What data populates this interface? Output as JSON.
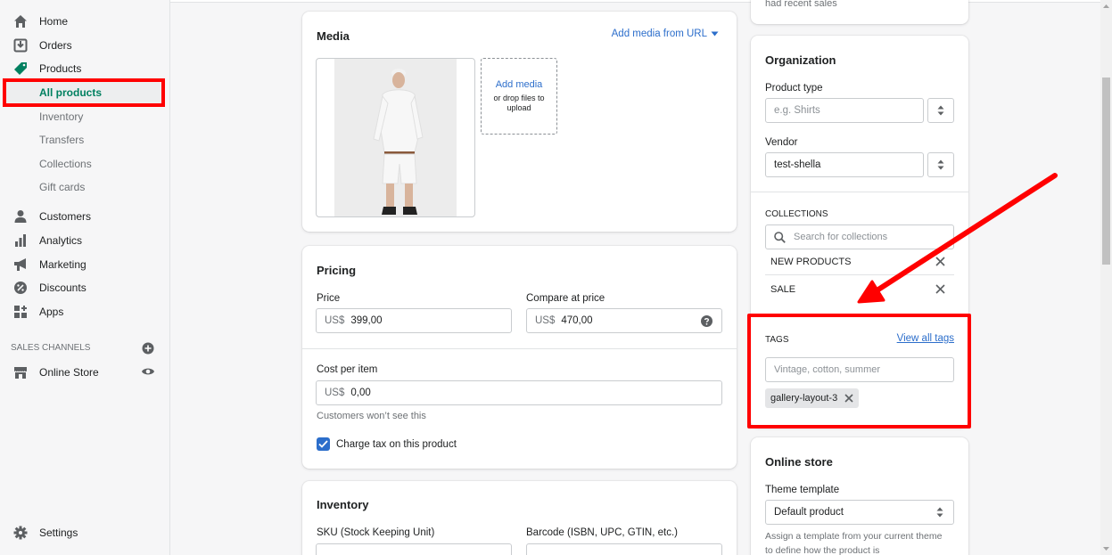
{
  "sidebar": {
    "items": [
      {
        "label": "Home",
        "icon": "home-icon"
      },
      {
        "label": "Orders",
        "icon": "orders-icon"
      },
      {
        "label": "Products",
        "icon": "tag-icon"
      },
      {
        "label": "Customers",
        "icon": "person-icon"
      },
      {
        "label": "Analytics",
        "icon": "bar-chart-icon"
      },
      {
        "label": "Marketing",
        "icon": "megaphone-icon"
      },
      {
        "label": "Discounts",
        "icon": "discount-icon"
      },
      {
        "label": "Apps",
        "icon": "apps-icon"
      }
    ],
    "product_subitems": [
      "All products",
      "Inventory",
      "Transfers",
      "Collections",
      "Gift cards"
    ],
    "sales_channels_title": "SALES CHANNELS",
    "online_store": "Online Store",
    "settings": "Settings"
  },
  "media": {
    "title": "Media",
    "add_from_url": "Add media from URL",
    "add_media": "Add media",
    "drop_hint": "or drop files to upload"
  },
  "pricing": {
    "title": "Pricing",
    "price_label": "Price",
    "price_prefix": "US$",
    "price_value": "399,00",
    "compare_label": "Compare at price",
    "compare_prefix": "US$",
    "compare_value": "470,00",
    "cost_label": "Cost per item",
    "cost_prefix": "US$",
    "cost_value": "0,00",
    "cost_hint": "Customers won’t see this",
    "charge_tax": "Charge tax on this product",
    "charge_tax_checked": true
  },
  "inventory": {
    "title": "Inventory",
    "sku_label": "SKU (Stock Keeping Unit)",
    "barcode_label": "Barcode (ISBN, UPC, GTIN, etc.)"
  },
  "top_card": {
    "text": "had recent sales"
  },
  "organization": {
    "title": "Organization",
    "product_type_label": "Product type",
    "product_type_placeholder": "e.g. Shirts",
    "vendor_label": "Vendor",
    "vendor_value": "test-shella",
    "collections_title": "COLLECTIONS",
    "collections_search_placeholder": "Search for collections",
    "collections": [
      "NEW PRODUCTS",
      "SALE"
    ],
    "tags_title": "TAGS",
    "view_all_tags": "View all tags",
    "tags_placeholder": "Vintage, cotton, summer",
    "tags": [
      "gallery-layout-3"
    ]
  },
  "online_store": {
    "title": "Online store",
    "theme_template_label": "Theme template",
    "theme_template_value": "Default product",
    "theme_hint": "Assign a template from your current theme to define how the product is"
  },
  "colors": {
    "accent_green": "#008060",
    "link_blue": "#2c6ecb",
    "annotation_red": "#ff0000"
  }
}
